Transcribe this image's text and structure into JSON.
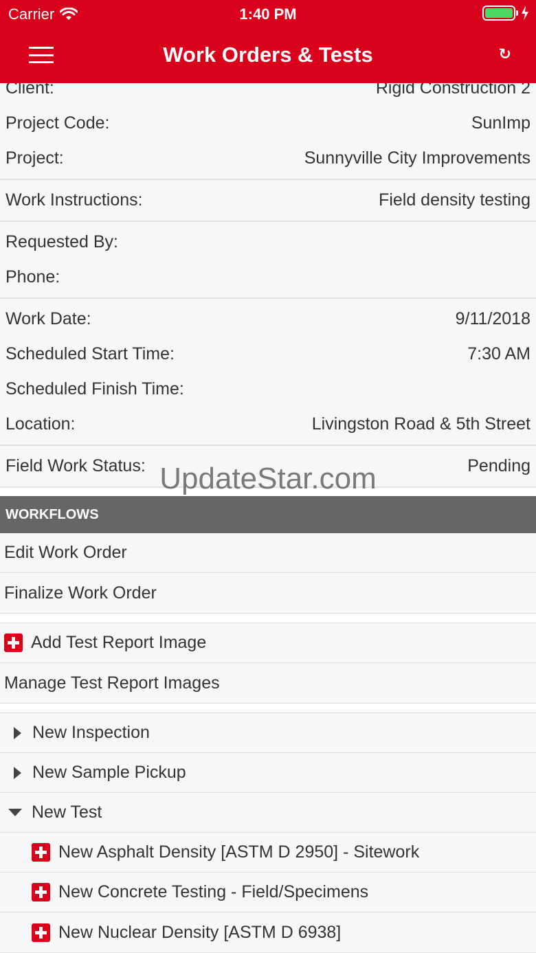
{
  "status_bar": {
    "carrier": "Carrier",
    "time": "1:40 PM"
  },
  "nav": {
    "title": "Work Orders & Tests",
    "refresh_glyph": "↻"
  },
  "info_groups": [
    [
      {
        "label": "Client:",
        "value": "Rigid Construction 2"
      },
      {
        "label": "Project Code:",
        "value": "SunImp"
      },
      {
        "label": "Project:",
        "value": "Sunnyville City Improvements"
      }
    ],
    [
      {
        "label": "Work Instructions:",
        "value": "Field density testing"
      }
    ],
    [
      {
        "label": "Requested By:",
        "value": ""
      },
      {
        "label": "Phone:",
        "value": ""
      }
    ],
    [
      {
        "label": "Work Date:",
        "value": "9/11/2018"
      },
      {
        "label": "Scheduled Start Time:",
        "value": "7:30 AM"
      },
      {
        "label": "Scheduled Finish Time:",
        "value": ""
      },
      {
        "label": "Location:",
        "value": "Livingston Road & 5th Street"
      }
    ],
    [
      {
        "label": "Field Work Status:",
        "value": "Pending"
      }
    ]
  ],
  "watermark": "UpdateStar.com",
  "workflows": {
    "header": "WORKFLOWS",
    "group1": [
      "Edit Work Order",
      "Finalize Work Order"
    ],
    "group2": {
      "add_image": "Add Test Report Image",
      "manage_images": "Manage Test Report Images"
    },
    "group3": {
      "new_inspection": "New Inspection",
      "new_sample_pickup": "New Sample Pickup",
      "new_test": "New Test",
      "tests": [
        "New Asphalt Density [ASTM D 2950] - Sitework",
        "New Concrete Testing - Field/Specimens",
        "New Nuclear Density [ASTM D 6938]"
      ]
    }
  },
  "colors": {
    "brand_red": "#d9001b",
    "header_gray": "#666666",
    "battery_green": "#4cd964"
  }
}
